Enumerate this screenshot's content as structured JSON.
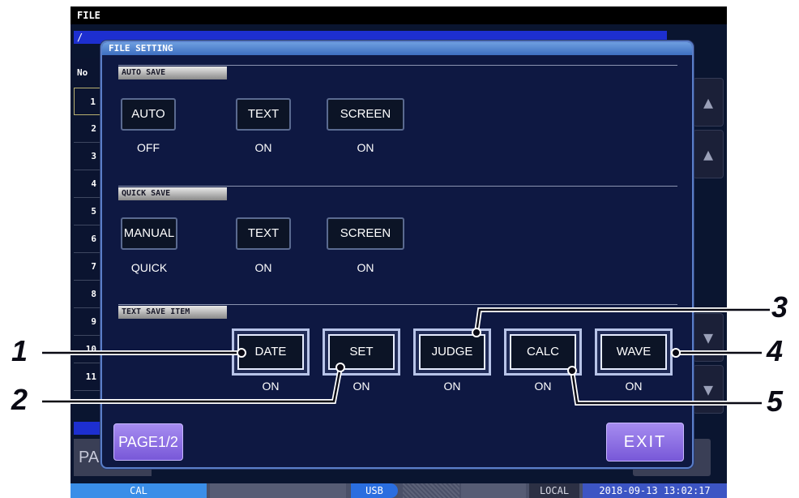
{
  "screen": {
    "title": "FILE",
    "path": "/",
    "list_header": "No",
    "row_numbers": [
      "1",
      "2",
      "3",
      "4",
      "5",
      "6",
      "7",
      "8",
      "9",
      "10",
      "11"
    ],
    "bg_button_label": "PA",
    "scroll_up_glyph": "▲",
    "scroll_down_glyph": "▼"
  },
  "status_bar": {
    "cal": "CAL",
    "usb": "USB",
    "local": "LOCAL",
    "datetime": "2018-09-13 13:02:17"
  },
  "dialog": {
    "title": "FILE SETTING",
    "auto_save": {
      "label": "AUTO SAVE",
      "buttons": [
        {
          "label": "AUTO",
          "value": "OFF"
        },
        {
          "label": "TEXT",
          "value": "ON"
        },
        {
          "label": "SCREEN",
          "value": "ON"
        }
      ]
    },
    "quick_save": {
      "label": "QUICK SAVE",
      "buttons": [
        {
          "label": "MANUAL",
          "value": "QUICK"
        },
        {
          "label": "TEXT",
          "value": "ON"
        },
        {
          "label": "SCREEN",
          "value": "ON"
        }
      ]
    },
    "text_save_item": {
      "label": "TEXT SAVE ITEM",
      "buttons": [
        {
          "label": "DATE",
          "value": "ON"
        },
        {
          "label": "SET",
          "value": "ON"
        },
        {
          "label": "JUDGE",
          "value": "ON"
        },
        {
          "label": "CALC",
          "value": "ON"
        },
        {
          "label": "WAVE",
          "value": "ON"
        }
      ]
    },
    "page_button": "PAGE1/2",
    "exit_button": "EXIT"
  },
  "callouts": [
    "1",
    "2",
    "3",
    "4",
    "5"
  ]
}
